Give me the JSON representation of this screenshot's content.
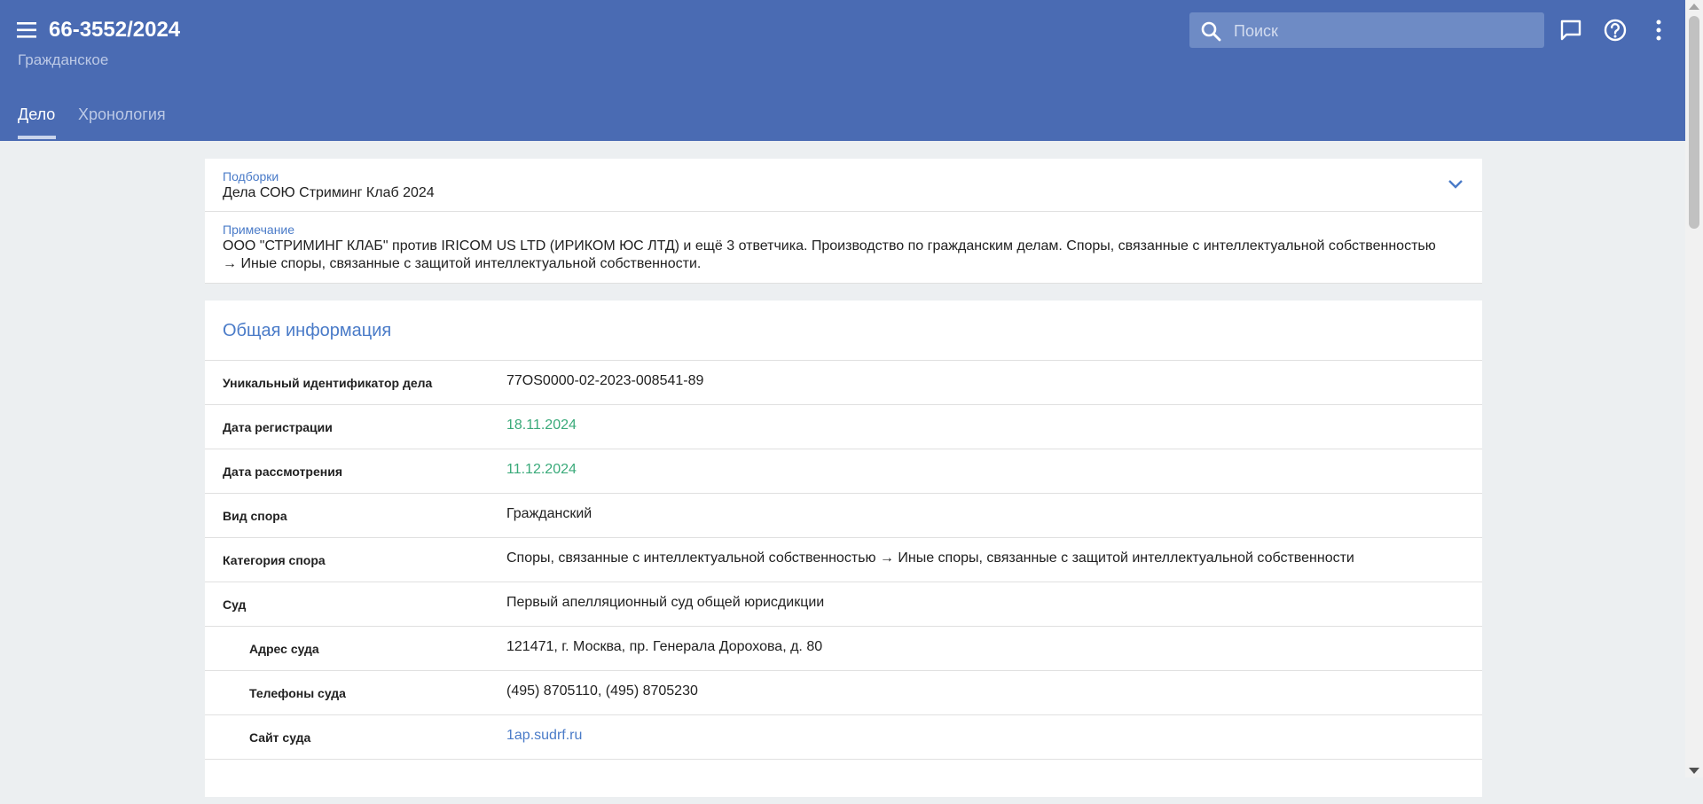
{
  "header": {
    "case_number": "66-3552/2024",
    "case_type": "Гражданское",
    "search_placeholder": "Поиск",
    "icons": [
      "menu-icon",
      "search-icon",
      "chat-icon",
      "help-icon",
      "more-vert-icon"
    ]
  },
  "tabs": [
    {
      "label": "Дело",
      "active": true
    },
    {
      "label": "Хронология",
      "active": false
    }
  ],
  "collections": {
    "label": "Подборки",
    "value": "Дела СОЮ Стриминг Клаб 2024"
  },
  "note": {
    "label": "Примечание",
    "line1": "ООО \"СТРИМИНГ КЛАБ\" против IRICOM US LTD (ИРИКОМ ЮС ЛТД) и ещё 3 ответчика. Производство по гражданским делам. Споры, связанные с интеллектуальной собственностью",
    "line2": "→ Иные споры, связанные с защитой интеллектуальной собственности."
  },
  "general": {
    "title": "Общая информация",
    "rows": [
      {
        "label": "Уникальный идентификатор дела",
        "value": "77OS0000-02-2023-008541-89"
      },
      {
        "label": "Дата регистрации",
        "value": "18.11.2024"
      },
      {
        "label": "Дата рассмотрения",
        "value": "11.12.2024"
      },
      {
        "label": "Вид спора",
        "value": "Гражданский"
      },
      {
        "label": "Категория спора",
        "value": "Споры, связанные с интеллектуальной собственностью → Иные споры, связанные с защитой интеллектуальной собственности"
      },
      {
        "label": "Суд",
        "value": "Первый апелляционный суд общей юрисдикции"
      },
      {
        "label": "Адрес суда",
        "value": "121471, г. Москва, пр. Генерала Дорохова, д. 80"
      },
      {
        "label": "Телефоны суда",
        "value": "(495) 8705110, (495) 8705230"
      },
      {
        "label": "Сайт суда",
        "value": "1ap.sudrf.ru"
      }
    ]
  },
  "colors": {
    "header": "#4a6bb3",
    "accent": "#4a7bc8",
    "date": "#3aaa7a",
    "background": "#eceff1"
  }
}
